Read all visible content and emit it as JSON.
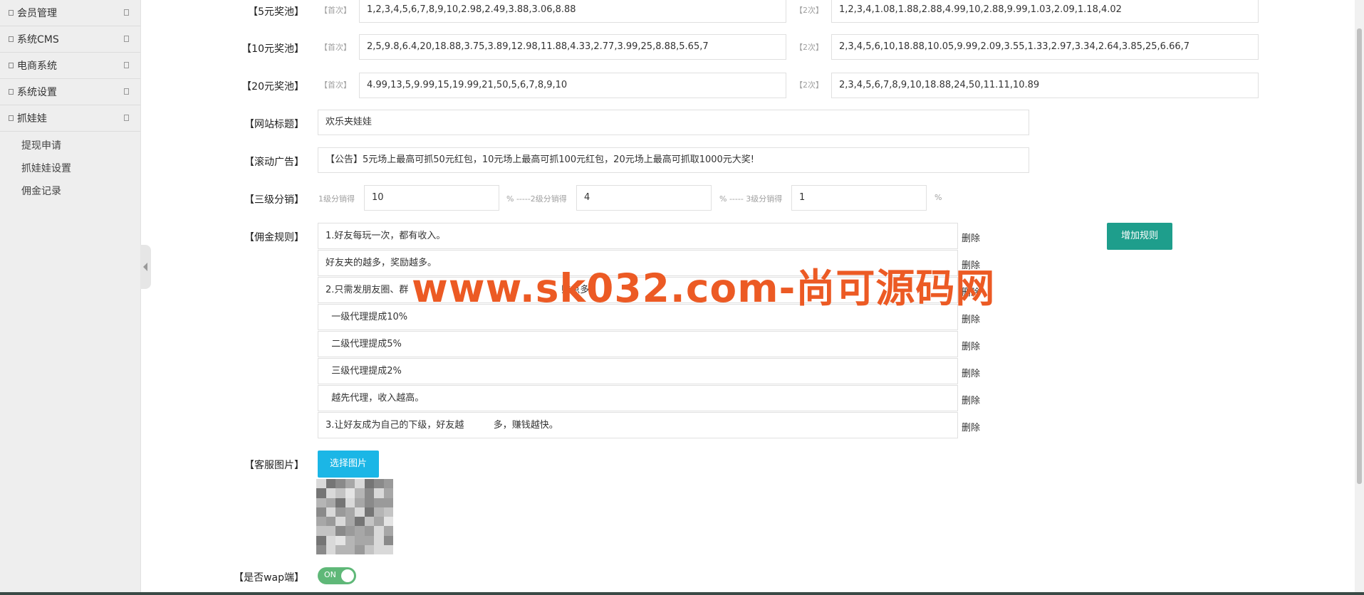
{
  "sidebar": {
    "items": [
      {
        "label": "会员管理"
      },
      {
        "label": "系统CMS"
      },
      {
        "label": "电商系统"
      },
      {
        "label": "系统设置"
      },
      {
        "label": "抓娃娃"
      }
    ],
    "sub_items": [
      {
        "label": "提现申请"
      },
      {
        "label": "抓娃娃设置"
      },
      {
        "label": "佣金记录"
      }
    ]
  },
  "pools": [
    {
      "label": "【5元奖池】",
      "first_hint": "【首次】",
      "first_value": "1,2,3,4,5,6,7,8,9,10,2.98,2.49,3.88,3.06,8.88",
      "second_hint": "【2次】",
      "second_value": "1,2,3,4,1.08,1.88,2.88,4.99,10,2.88,9.99,1.03,2.09,1.18,4.02"
    },
    {
      "label": "【10元奖池】",
      "first_hint": "【首次】",
      "first_value": "2,5,9.8,6.4,20,18.88,3.75,3.89,12.98,11.88,4.33,2.77,3.99,25,8.88,5.65,7",
      "second_hint": "【2次】",
      "second_value": "2,3,4,5,6,10,18.88,10.05,9.99,2.09,3.55,1.33,2.97,3.34,2.64,3.85,25,6.66,7"
    },
    {
      "label": "【20元奖池】",
      "first_hint": "【首次】",
      "first_value": "4.99,13,5,9.99,15,19.99,21,50,5,6,7,8,9,10",
      "second_hint": "【2次】",
      "second_value": "2,3,4,5,6,7,8,9,10,18.88,24,50,11.11,10.89"
    }
  ],
  "site_title": {
    "label": "【网站标题】",
    "value": "欢乐夹娃娃"
  },
  "scroll_ad": {
    "label": "【滚动广告】",
    "value": "【公告】5元场上最高可抓50元红包，10元场上最高可抓100元红包，20元场上最高可抓取1000元大奖!"
  },
  "distribution": {
    "label": "【三级分销】",
    "level1_hint": "1级分销得",
    "level1_value": "10",
    "level2_hint": "% -----2级分销得",
    "level2_value": "4",
    "level3_hint": "% ----- 3级分销得",
    "level3_value": "1",
    "pct": "%"
  },
  "commission": {
    "label": "【佣金规则】",
    "delete_label": "删除",
    "add_button": "增加规则",
    "rules": [
      "1.好友每玩一次，都有收入。",
      "好友夹的越多，奖励越多。",
      "2.只需发朋友圈、群                                                    赚点多",
      "  一级代理提成10%",
      "  二级代理提成5%",
      "  三级代理提成2%",
      "  越先代理，收入越高。",
      "3.让好友成为自己的下级，好友越          多，赚钱越快。"
    ]
  },
  "service_image": {
    "label": "【客服图片】",
    "button": "选择图片"
  },
  "wap": {
    "label": "【是否wap端】",
    "toggle_text": "ON"
  },
  "watermark": "www.sk032.com-尚可源码网"
}
